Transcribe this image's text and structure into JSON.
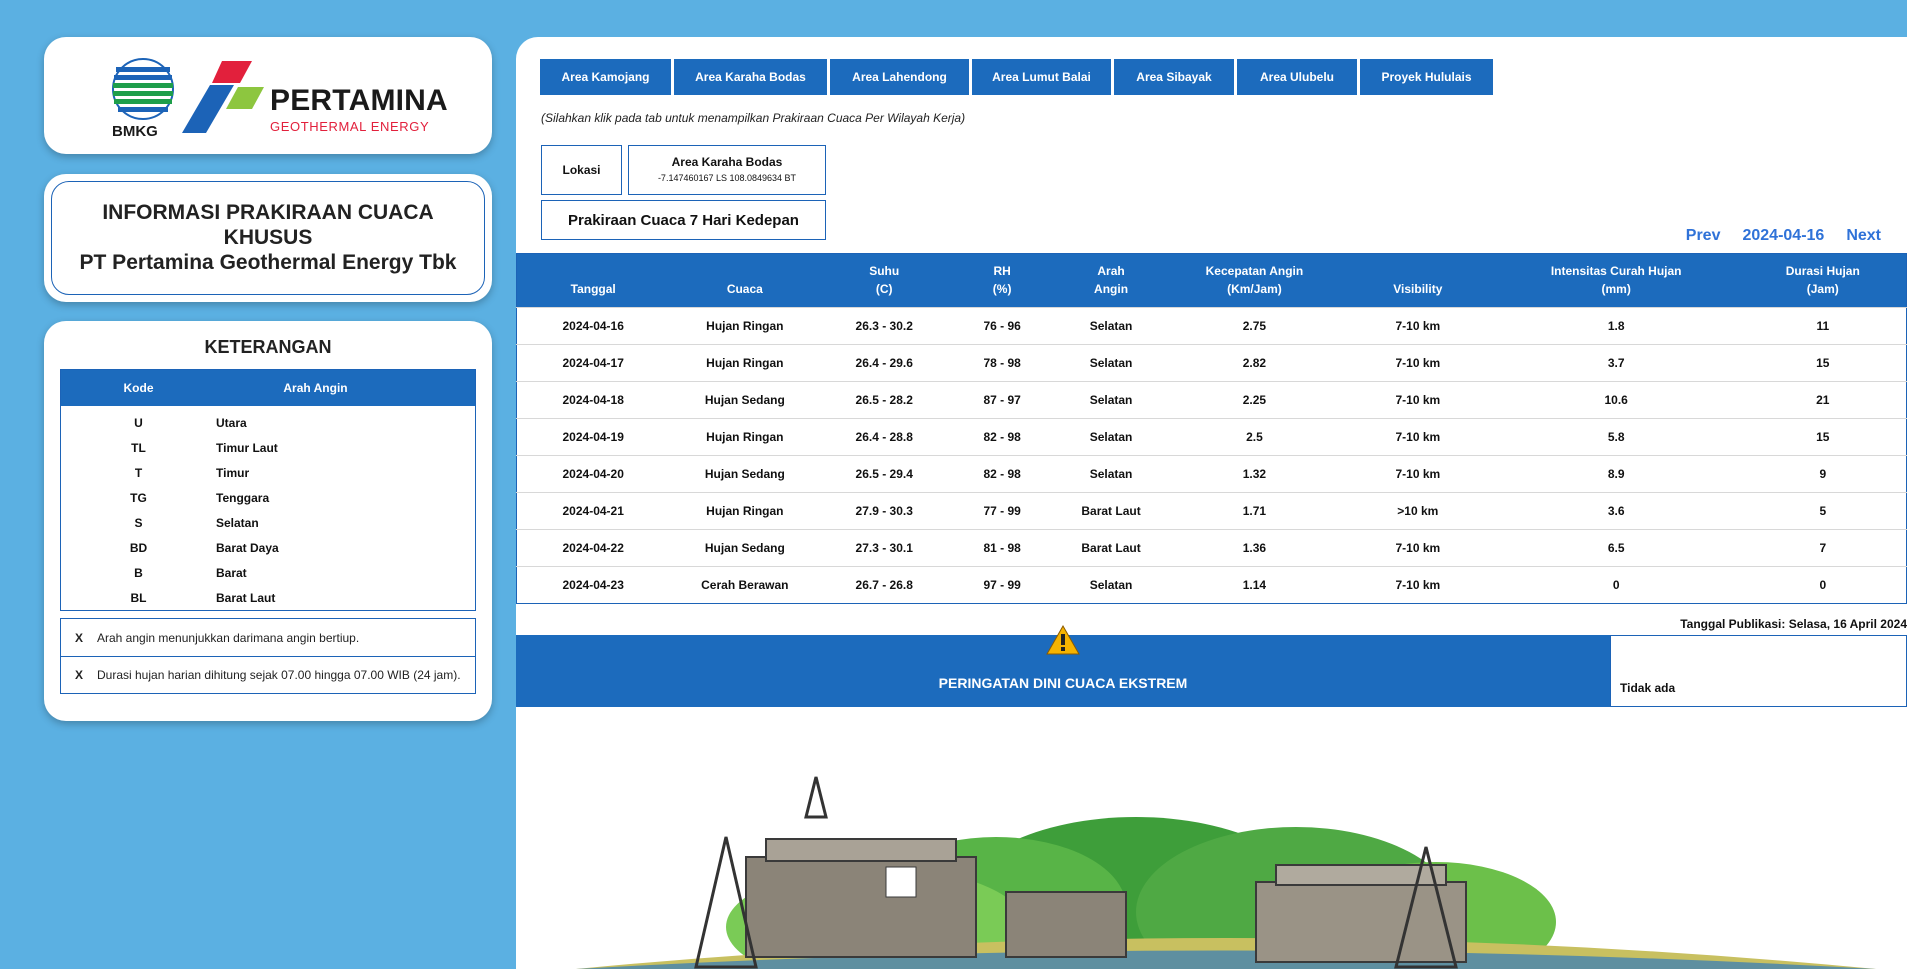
{
  "logos": {
    "bmkg": "BMKG",
    "pertamina": "PERTAMINA",
    "pertamina_sub": "GEOTHERMAL ENERGY"
  },
  "title": {
    "line1": "INFORMASI PRAKIRAAN CUACA KHUSUS",
    "line2": "PT Pertamina Geothermal Energy Tbk"
  },
  "keterangan": {
    "title": "KETERANGAN",
    "col_kode": "Kode",
    "col_arah": "Arah Angin",
    "rows": [
      {
        "kode": "U",
        "arah": "Utara"
      },
      {
        "kode": "TL",
        "arah": "Timur Laut"
      },
      {
        "kode": "T",
        "arah": "Timur"
      },
      {
        "kode": "TG",
        "arah": "Tenggara"
      },
      {
        "kode": "S",
        "arah": "Selatan"
      },
      {
        "kode": "BD",
        "arah": "Barat Daya"
      },
      {
        "kode": "B",
        "arah": "Barat"
      },
      {
        "kode": "BL",
        "arah": "Barat Laut"
      }
    ],
    "notes": [
      {
        "mark": "X",
        "text": "Arah angin menunjukkan darimana angin bertiup."
      },
      {
        "mark": "X",
        "text": "Durasi hujan harian dihitung sejak 07.00 hingga 07.00 WIB (24 jam)."
      }
    ]
  },
  "tabs": [
    {
      "label": "Area Kamojang"
    },
    {
      "label": "Area Karaha Bodas"
    },
    {
      "label": "Area Lahendong"
    },
    {
      "label": "Area Lumut Balai"
    },
    {
      "label": "Area Sibayak"
    },
    {
      "label": "Area Ulubelu"
    },
    {
      "label": "Proyek Hululais"
    }
  ],
  "hint": "(Silahkan klik pada tab untuk menampilkan Prakiraan Cuaca Per Wilayah Kerja)",
  "lokasi": {
    "label": "Lokasi",
    "name": "Area Karaha Bodas",
    "coords": "-7.147460167 LS 108.0849634 BT"
  },
  "forecast_title": "Prakiraan Cuaca 7 Hari Kedepan",
  "nav": {
    "prev": "Prev",
    "date": "2024-04-16",
    "next": "Next"
  },
  "table": {
    "headers": [
      [
        "",
        "Tanggal"
      ],
      [
        "",
        "Cuaca"
      ],
      [
        "Suhu",
        "(C)"
      ],
      [
        "RH",
        "(%)"
      ],
      [
        "Arah",
        "Angin"
      ],
      [
        "Kecepatan Angin",
        "(Km/Jam)"
      ],
      [
        "",
        "Visibility"
      ],
      [
        "Intensitas Curah Hujan",
        "(mm)"
      ],
      [
        "Durasi Hujan",
        "(Jam)"
      ]
    ],
    "rows": [
      [
        "2024-04-16",
        "Hujan Ringan",
        "26.3 - 30.2",
        "76 - 96",
        "Selatan",
        "2.75",
        "7-10 km",
        "1.8",
        "11"
      ],
      [
        "2024-04-17",
        "Hujan Ringan",
        "26.4 - 29.6",
        "78 - 98",
        "Selatan",
        "2.82",
        "7-10 km",
        "3.7",
        "15"
      ],
      [
        "2024-04-18",
        "Hujan Sedang",
        "26.5 - 28.2",
        "87 - 97",
        "Selatan",
        "2.25",
        "7-10 km",
        "10.6",
        "21"
      ],
      [
        "2024-04-19",
        "Hujan Ringan",
        "26.4 - 28.8",
        "82 - 98",
        "Selatan",
        "2.5",
        "7-10 km",
        "5.8",
        "15"
      ],
      [
        "2024-04-20",
        "Hujan Sedang",
        "26.5 - 29.4",
        "82 - 98",
        "Selatan",
        "1.32",
        "7-10 km",
        "8.9",
        "9"
      ],
      [
        "2024-04-21",
        "Hujan Ringan",
        "27.9 - 30.3",
        "77 - 99",
        "Barat Laut",
        "1.71",
        ">10 km",
        "3.6",
        "5"
      ],
      [
        "2024-04-22",
        "Hujan Sedang",
        "27.3 - 30.1",
        "81 - 98",
        "Barat Laut",
        "1.36",
        "7-10 km",
        "6.5",
        "7"
      ],
      [
        "2024-04-23",
        "Cerah Berawan",
        "26.7 - 26.8",
        "97 - 99",
        "Selatan",
        "1.14",
        "7-10 km",
        "0",
        "0"
      ]
    ]
  },
  "publikasi": "Tanggal Publikasi: Selasa, 16 April 2024",
  "peringatan": {
    "title": "PERINGATAN DINI CUACA EKSTREM",
    "value": "Tidak ada"
  },
  "colors": {
    "accent": "#1C6BBD",
    "background": "#5BB0E2",
    "link": "#2F72D8",
    "brand_red": "#E2203C"
  }
}
